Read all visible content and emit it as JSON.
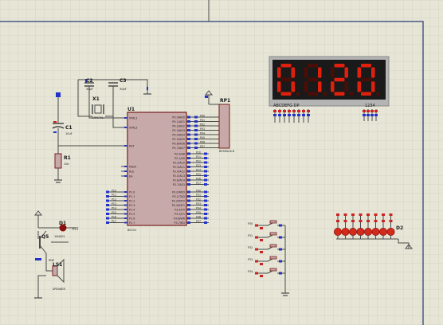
{
  "colors": {
    "background": "#e6e5d6",
    "grid": "#d2d1c2",
    "sheet_border": "#4a5a86",
    "wire": "#4a4a4a",
    "component_body": "#c8a9a9",
    "component_outline": "#7a1f1f",
    "label": "#1a1a1a",
    "pin_blue": "#2233cc",
    "pin_red": "#cc2222",
    "led_red": "#d42a1a",
    "seg_on": "#e0200c",
    "seg_off": "#4a0d07",
    "display_body": "#1a1a1a",
    "display_frame": "#b4b4b4"
  },
  "components": {
    "c2": {
      "ref": "C2",
      "value": "30pF"
    },
    "c3": {
      "ref": "C3",
      "value": "30pF"
    },
    "x1": {
      "ref": "X1",
      "value": "CRYSTAL"
    },
    "c1": {
      "ref": "C1",
      "value": "10uF"
    },
    "r1": {
      "ref": "R1",
      "value": "10k"
    },
    "u1": {
      "ref": "U1",
      "part": "80C51"
    },
    "rp1": {
      "ref": "RP1",
      "value": "RESPACK-8"
    },
    "d1": {
      "ref": "D1",
      "part": "1N4001"
    },
    "q5": {
      "ref": "Q5",
      "part": "PNP"
    },
    "ls1": {
      "ref": "LS1",
      "part": "SPEAKER"
    },
    "d2": {
      "ref": "D2"
    }
  },
  "display": {
    "digits": [
      "0",
      "1",
      "2",
      "0"
    ],
    "segment_label": "ABCDEFG DP",
    "digit_label": "1234"
  },
  "u1_pins": {
    "left_top": [
      "XTAL1",
      "XTAL2"
    ],
    "left_mid": [
      "RST"
    ],
    "left_ctrl": [
      "PSEN",
      "ALE",
      "EA"
    ],
    "left_p1": [
      "P1.0",
      "P1.1",
      "P1.2",
      "P1.3",
      "P1.4",
      "P1.5",
      "P1.6",
      "P1.7"
    ],
    "right_p0": [
      "P0.0/AD0",
      "P0.1/AD1",
      "P0.2/AD2",
      "P0.3/AD3",
      "P0.4/AD4",
      "P0.5/AD5",
      "P0.6/AD6",
      "P0.7/AD7"
    ],
    "right_p2": [
      "P2.0/A8",
      "P2.1/A9",
      "P2.2/A10",
      "P2.3/A11",
      "P2.4/A12",
      "P2.5/A13",
      "P2.6/A14",
      "P2.7/A15"
    ],
    "right_p3": [
      "P3.0/RXD",
      "P3.1/TXD",
      "P3.2/INT0",
      "P3.3/INT1",
      "P3.4/T0",
      "P3.5/T1",
      "P3.6/WR",
      "P3.7/RD"
    ]
  },
  "tags": {
    "p0_bus": [
      "P00",
      "P01",
      "P02",
      "P03",
      "P04",
      "P05",
      "P06",
      "P07"
    ],
    "p1_left": [
      "P10",
      "P11",
      "P12",
      "P13",
      "P14",
      "P15",
      "P16",
      "P17"
    ],
    "p2_right": [
      "P20",
      "P21",
      "P22",
      "P23",
      "P24",
      "P25",
      "P26",
      "P27"
    ],
    "p3_right": [
      "P30",
      "P31",
      "P32",
      "P33",
      "P34",
      "P35",
      "P36",
      "P37"
    ],
    "buttons": [
      "P30",
      "P31",
      "P32",
      "P33",
      "P34"
    ],
    "speaker_tag": "P37"
  }
}
